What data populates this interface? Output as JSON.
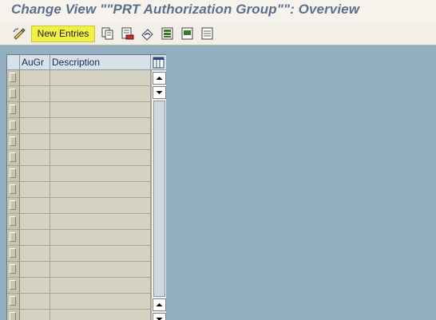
{
  "window": {
    "title": "Change View \"\"PRT Authorization Group\"\": Overview"
  },
  "toolbar": {
    "new_entries_label": "New Entries",
    "buttons": [
      {
        "name": "display-change-icon"
      },
      {
        "name": "copy-as-icon"
      },
      {
        "name": "delete-icon"
      },
      {
        "name": "undo-change-icon"
      },
      {
        "name": "select-all-icon"
      },
      {
        "name": "select-block-icon"
      },
      {
        "name": "deselect-all-icon"
      }
    ]
  },
  "table": {
    "columns": [
      {
        "label": "AuGr"
      },
      {
        "label": "Description"
      }
    ],
    "row_count": 16,
    "rows": []
  },
  "colors": {
    "title_text": "#5d6f8e",
    "new_entries_bg": "#f1f145",
    "workspace_bg": "#93aec1",
    "table_cell_bg": "#d6d2c2",
    "header_bg": "#d6e1ea"
  }
}
